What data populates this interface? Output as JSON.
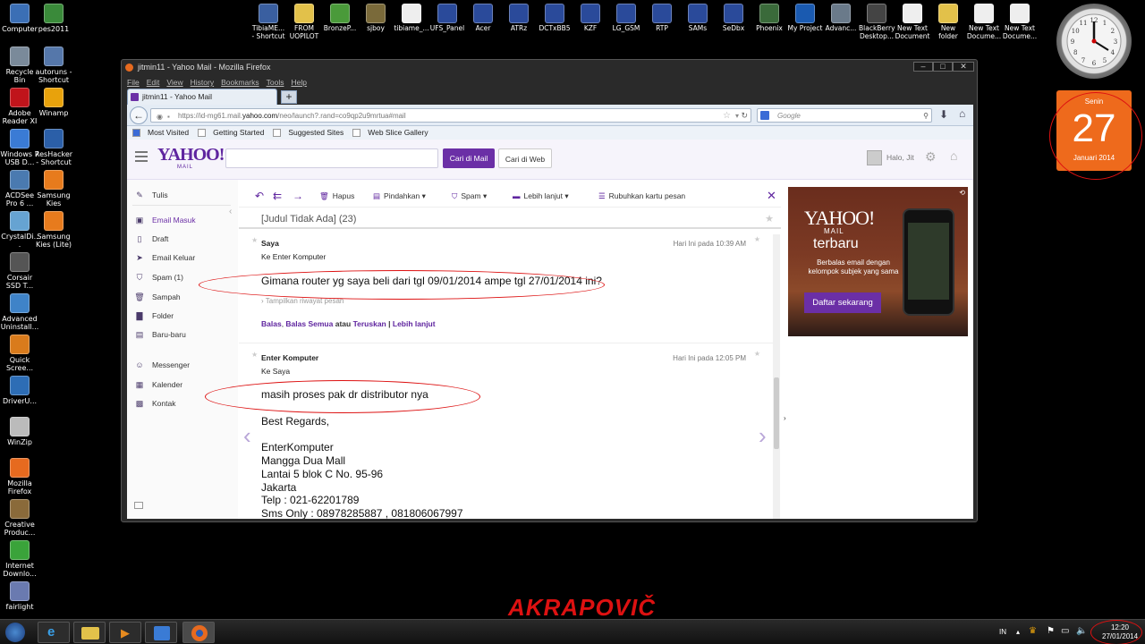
{
  "desktop": {
    "left_icons": [
      {
        "label": "Computer",
        "color": "#3b6fb5"
      },
      {
        "label": "pes2011",
        "color": "#3a8a3a"
      },
      {
        "label": "Recycle Bin",
        "color": "#7a8a9a"
      },
      {
        "label": "autoruns - Shortcut",
        "color": "#5577aa"
      },
      {
        "label": "Adobe Reader XI",
        "color": "#c0141b"
      },
      {
        "label": "Winamp",
        "color": "#e8a20c"
      },
      {
        "label": "Windows 7 USB D...",
        "color": "#3a7bd5"
      },
      {
        "label": "ResHacker - Shortcut",
        "color": "#2b5fa8"
      },
      {
        "label": "ACDSee Pro 6 ...",
        "color": "#4a7ab0"
      },
      {
        "label": "Samsung Kies",
        "color": "#e77b1d"
      },
      {
        "label": "CrystalDi...",
        "color": "#66a3d2"
      },
      {
        "label": "Samsung Kies (Lite)",
        "color": "#e77b1d"
      },
      {
        "label": "Corsair SSD T...",
        "color": "#555"
      },
      {
        "label": "Advanced Uninstall...",
        "color": "#3f83c8"
      },
      {
        "label": "Quick Scree...",
        "color": "#d97b1c"
      },
      {
        "label": "DriverU...",
        "color": "#2d6db5"
      },
      {
        "label": "WinZip",
        "color": "#bbb"
      },
      {
        "label": "Mozilla Firefox",
        "color": "#e66a1f"
      },
      {
        "label": "Creative Produc...",
        "color": "#8a6a3a"
      },
      {
        "label": "Internet Downlo...",
        "color": "#3aa33a"
      },
      {
        "label": "fairlight",
        "color": "#6a7ab0"
      }
    ],
    "top_icons": [
      {
        "label": "TibiaME... - Shortcut",
        "color": "#3a5fa0"
      },
      {
        "label": "FROM UOPILOT",
        "color": "#e2c14a"
      },
      {
        "label": "BronzeP...",
        "color": "#4a9a3a"
      },
      {
        "label": "sjboy",
        "color": "#7a6a3a"
      },
      {
        "label": "tibiame_...",
        "color": "#eee"
      },
      {
        "label": "UFS_Panel",
        "color": "#2a4a9a"
      },
      {
        "label": "Acer",
        "color": "#2a4a9a"
      },
      {
        "label": "ATRz",
        "color": "#2a4a9a"
      },
      {
        "label": "DCTxBB5",
        "color": "#2a4a9a"
      },
      {
        "label": "KZF",
        "color": "#2a4a9a"
      },
      {
        "label": "LG_GSM",
        "color": "#2a4a9a"
      },
      {
        "label": "RTP",
        "color": "#2a4a9a"
      },
      {
        "label": "SAMs",
        "color": "#2a4a9a"
      },
      {
        "label": "SeDbx",
        "color": "#2a4a9a"
      },
      {
        "label": "Phoenix",
        "color": "#3a6a3a"
      },
      {
        "label": "My Project",
        "color": "#1a5ab0"
      },
      {
        "label": "Advanc...",
        "color": "#6a7a8a"
      },
      {
        "label": "BlackBerry Desktop...",
        "color": "#444"
      },
      {
        "label": "New Text Document",
        "color": "#eee"
      },
      {
        "label": "New folder",
        "color": "#e2c14a"
      },
      {
        "label": "New Text Docume...",
        "color": "#eee"
      },
      {
        "label": "New Text Docume...",
        "color": "#eee"
      }
    ],
    "calendar": {
      "day": "Senin",
      "date": "27",
      "month": "Januari 2014"
    },
    "clock": {
      "hour": "12",
      "minute": "20"
    },
    "watermark": "AKRAPOVIČ"
  },
  "window": {
    "title": "jitmin11 - Yahoo Mail - Mozilla Firefox",
    "menu": [
      "File",
      "Edit",
      "View",
      "History",
      "Bookmarks",
      "Tools",
      "Help"
    ],
    "tab_label": "jitmin11 - Yahoo Mail",
    "new_tab": "+",
    "url_prefix": "https://id-mg61.mail.",
    "url_domain": "yahoo.com",
    "url_rest": "/neo/launch?.rand=co9qp2u9mrtua#mail",
    "search_placeholder": "Google",
    "bookmarks": [
      "Most Visited",
      "Getting Started",
      "Suggested Sites",
      "Web Slice Gallery"
    ]
  },
  "yahoo": {
    "logo": "YAHOO!",
    "logo_sub": "MAIL",
    "btn_search_mail": "Cari di Mail",
    "btn_search_web": "Cari di Web",
    "greeting": "Halo, Jit",
    "sidebar": [
      {
        "label": "Tulis",
        "icon": "compose-icon"
      },
      {
        "label": "Email Masuk",
        "icon": "inbox-icon"
      },
      {
        "label": "Draft",
        "icon": "draft-icon"
      },
      {
        "label": "Email Keluar",
        "icon": "sent-icon"
      },
      {
        "label": "Spam (1)",
        "icon": "spam-icon"
      },
      {
        "label": "Sampah",
        "icon": "trash-icon"
      },
      {
        "label": "Folder",
        "icon": "folder-icon"
      },
      {
        "label": "Baru-baru",
        "icon": "recent-icon"
      },
      {
        "label": "Messenger",
        "icon": "messenger-icon"
      },
      {
        "label": "Kalender",
        "icon": "calendar-icon"
      },
      {
        "label": "Kontak",
        "icon": "contacts-icon"
      }
    ],
    "toolbar": {
      "delete": "Hapus",
      "move": "Pindahkan",
      "spam": "Spam",
      "more": "Lebih lanjut",
      "summary": "Rubuhkan kartu pesan"
    },
    "subject": "[Judul Tidak Ada] (23)",
    "messages": [
      {
        "sender": "Saya",
        "to": "Ke  Enter Komputer",
        "time": "Hari Ini pada 10:39 AM",
        "body": "Gimana router yg saya beli dari tgl 09/01/2014 ampe tgl 27/01/2014 ini?",
        "history": "Tampilkan riwayat pesan",
        "reply": "Balas",
        "reply_all": "Balas Semua",
        "or": "atau",
        "forward": "Teruskan",
        "sep": "|",
        "more": "Lebih lanjut"
      },
      {
        "sender": "Enter Komputer",
        "to": "Ke  Saya",
        "time": "Hari Ini pada 12:05 PM",
        "body": "masih proses pak dr distributor nya",
        "signature": [
          "Best Regards,",
          "",
          "EnterKomputer",
          "Mangga Dua Mall",
          "Lantai 5 blok C No. 95-96",
          "Jakarta",
          "Telp : 021-62201789",
          "Sms Only : 08978285887 , 081806067997"
        ]
      }
    ],
    "ad": {
      "brand": "YAHOO!",
      "brand_sub": "MAIL",
      "headline": "terbaru",
      "text": "Berbalas email dengan kelompok subjek yang sama",
      "cta": "Daftar sekarang"
    }
  },
  "taskbar": {
    "lang": "IN",
    "time": "12:20",
    "date": "27/01/2014"
  }
}
